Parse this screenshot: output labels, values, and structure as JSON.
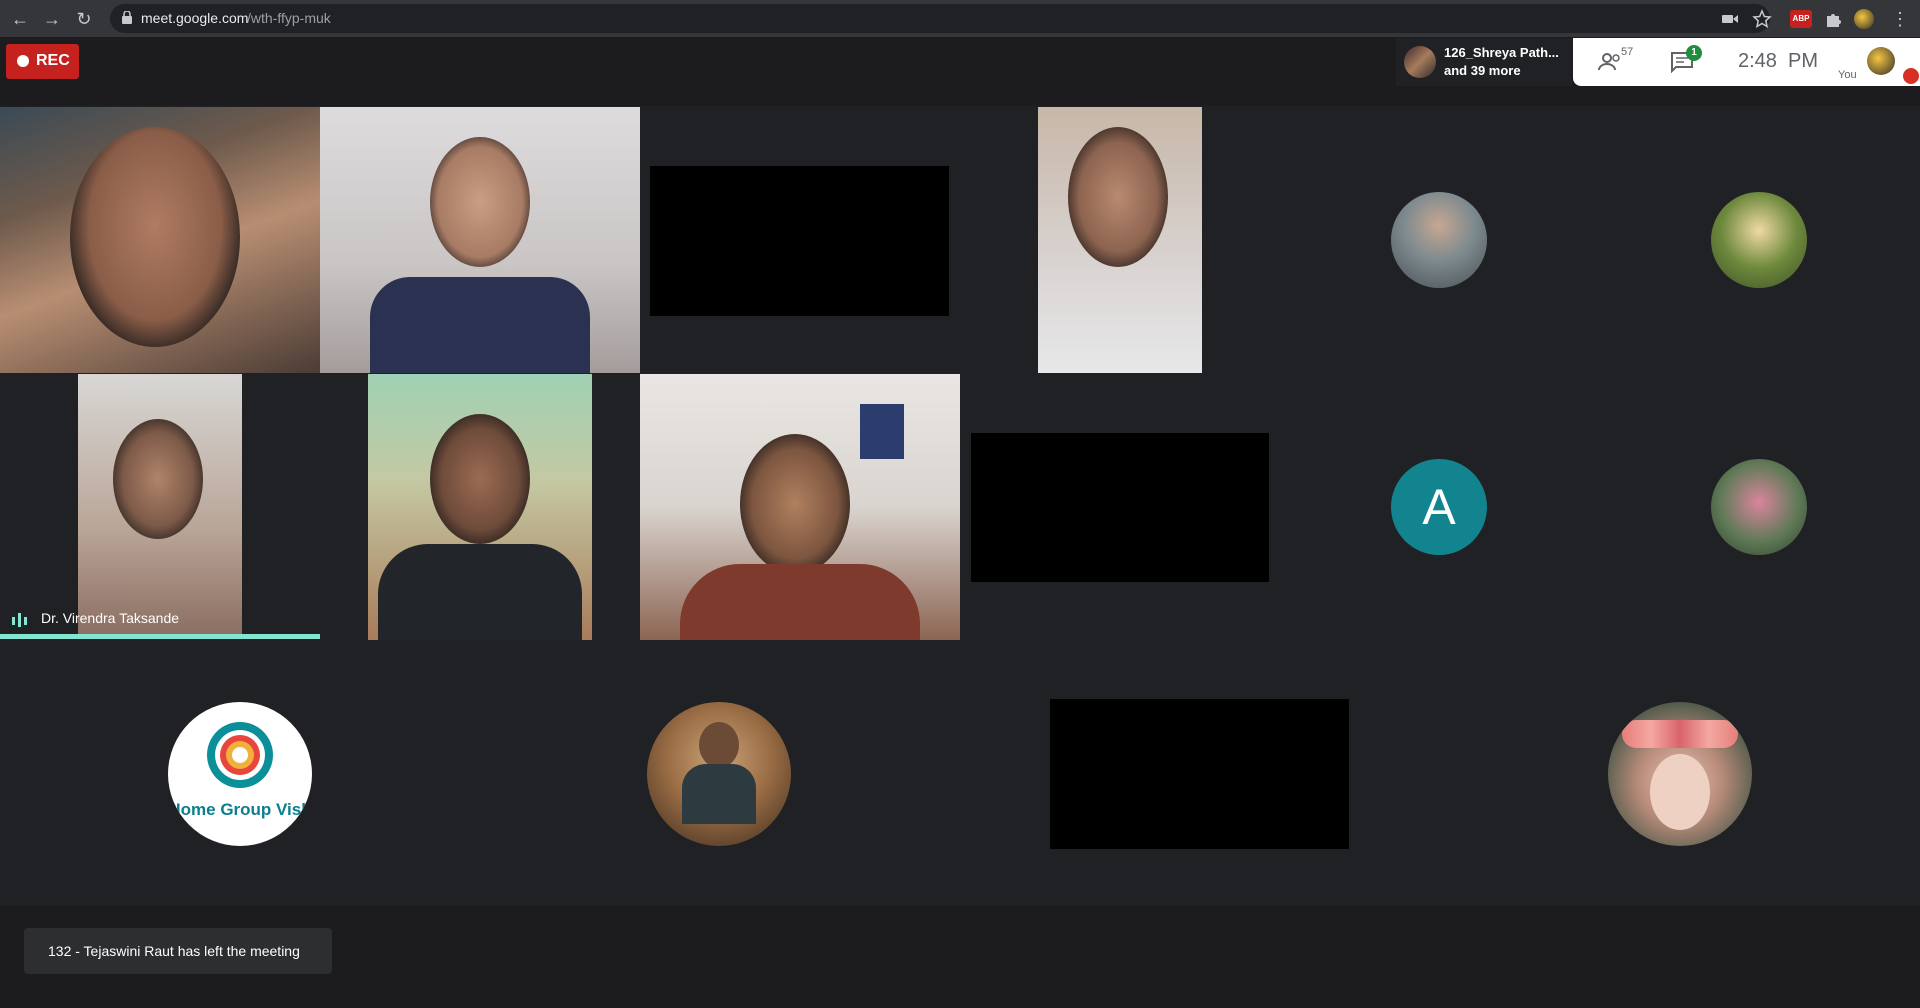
{
  "browser": {
    "url_host": "meet.google.com",
    "url_path": "/wth-ffyp-muk",
    "extension_abp": "ABP"
  },
  "recording": {
    "label": "REC"
  },
  "presenter": {
    "name": "126_Shreya Path...",
    "more": "and 39 more"
  },
  "controls": {
    "people_count": "57",
    "chat_badge": "1",
    "time": "2:48  PM",
    "self_label": "You"
  },
  "participants": {
    "active_speaker": "Dr. Virendra Taksande",
    "letter_avatar": "A",
    "home_group_logo": "Home Group Vish"
  },
  "notification": {
    "text": "132 - Tejaswini Raut has left the meeting"
  },
  "colors": {
    "background": "#202124",
    "rec_red": "#c5221f",
    "speaker_teal": "#82e6d2",
    "avatar_teal": "#12848f",
    "badge_green": "#1e8e3e"
  }
}
